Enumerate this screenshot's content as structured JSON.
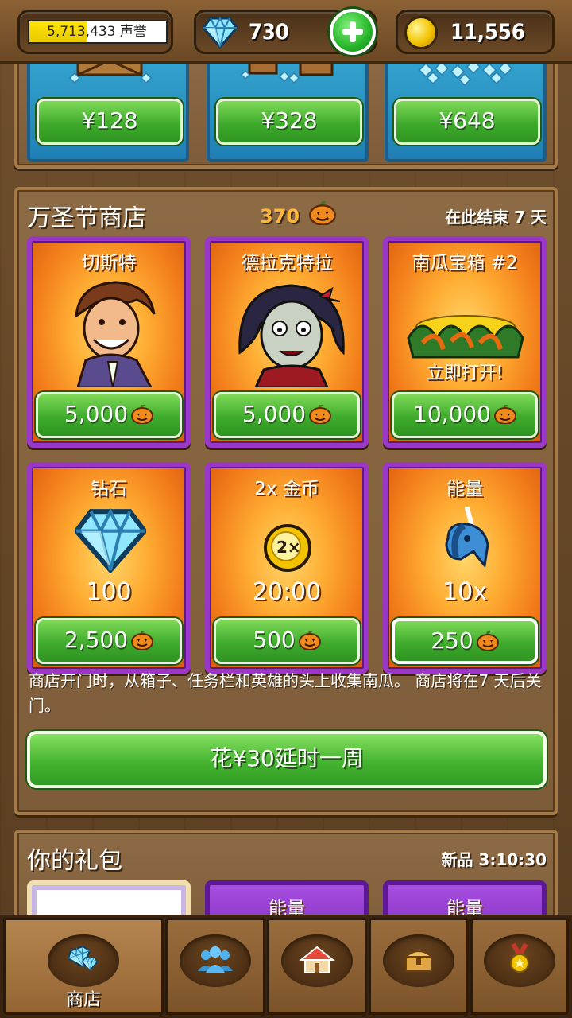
{
  "top_bar": {
    "fame": {
      "text": "5,713,433 声誉",
      "progress": 0.42
    },
    "gems": {
      "value": "730",
      "icon": "diamond-icon"
    },
    "coins": {
      "value": "11,556",
      "icon": "gold-coin-icon"
    },
    "add_button_icon": "plus-icon"
  },
  "diamond_packs": [
    {
      "price": "¥128"
    },
    {
      "price": "¥328"
    },
    {
      "price": "¥648"
    }
  ],
  "halloween_shop": {
    "title": "万圣节商店",
    "pumpkin_balance": "370",
    "ends_text": "在此结束 7 天",
    "items": [
      {
        "title": "切斯特",
        "value": "",
        "price": "5,000",
        "art": "hero-chester"
      },
      {
        "title": "德拉克特拉",
        "value": "",
        "price": "5,000",
        "art": "hero-vampire"
      },
      {
        "title": "南瓜宝箱 #2",
        "value": "立即打开!",
        "price": "10,000",
        "art": "pumpkin-chest"
      },
      {
        "title": "钻石",
        "value": "100",
        "price": "2,500",
        "art": "diamond"
      },
      {
        "title": "2x 金币",
        "value": "20:00",
        "price": "500",
        "art": "2x-coin"
      },
      {
        "title": "能量",
        "value": "10x",
        "price": "250",
        "art": "unicorn-energy"
      }
    ],
    "description": "商店开门时，从箱子、任务栏和英雄的头上收集南瓜。 商店将在7 天后关门。",
    "extend_button": "花¥30延时一周"
  },
  "bundles": {
    "title": "你的礼包",
    "new_text": "新品 3:10:30",
    "cards": [
      {
        "title": ""
      },
      {
        "title": "能量"
      },
      {
        "title": "能量"
      }
    ]
  },
  "bottom_nav": [
    {
      "label": "商店",
      "icon": "diamonds-icon",
      "active": true
    },
    {
      "label": "",
      "icon": "heroes-icon",
      "active": false
    },
    {
      "label": "",
      "icon": "town-icon",
      "active": false
    },
    {
      "label": "",
      "icon": "treasure-chest-icon",
      "active": false
    },
    {
      "label": "",
      "icon": "achievement-medal-icon",
      "active": false
    }
  ],
  "colors": {
    "wood": "#7d5c39",
    "card_border": "#9b37c7",
    "button_green": "#45b430",
    "pumpkin_orange": "#f27c1a",
    "diamond_blue": "#35a5cf"
  }
}
